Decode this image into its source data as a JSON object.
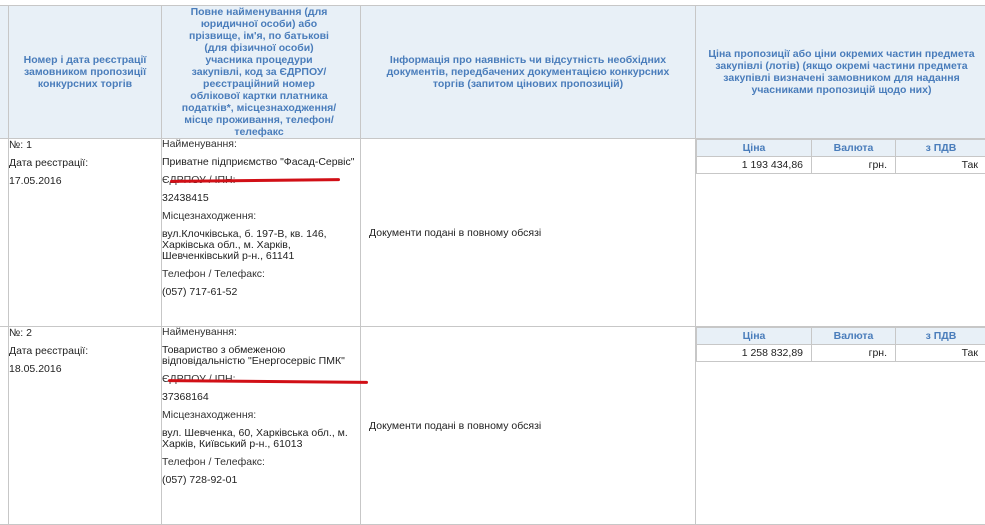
{
  "headers": {
    "number_date": "Номер і дата реєстрації замовником пропозиції конкурсних торгів",
    "participant": "Повне найменування (для юридичної особи) або прізвище, ім'я, по батькові (для фізичної особи) учасника процедури закупівлі, код за ЄДРПОУ/ реєстраційний номер облікової картки платника податків*, місцезнаходження/ місце проживання, телефон/ телефакс",
    "documents": "Інформація про наявність чи відсутність необхідних документів, передбачених документацією конкурсних торгів (запитом цінових пропозицій)",
    "price": "Ціна пропозиції або ціни окремих частин предмета закупівлі (лотів) (якщо окремі частини предмета закупівлі визначені замовником для надання учасниками пропозицій щодо них)"
  },
  "price_headers": {
    "price": "Ціна",
    "currency": "Валюта",
    "vat": "з ПДВ"
  },
  "rows": [
    {
      "number": "№: 1",
      "reg_label": "Дата реєстрації:",
      "reg_date": "17.05.2016",
      "name_label": "Найменування:",
      "name": "Приватне підприємство \"Фасад-Сервіс\"",
      "edrpou_label": "ЄДРПОУ / ІПН:",
      "edrpou": "32438415",
      "address_label": "Місцезнаходження:",
      "address": "вул.Клочківська, б. 197-В, кв. 146, Харківська обл., м. Харків, Шевченківський р-н., 61141",
      "phone_label": "Телефон / Телефакс:",
      "phone": "(057) 717-61-52",
      "documents": "Документи подані в повному обсязі",
      "price": "1 193 434,86",
      "currency": "грн.",
      "vat": "Так"
    },
    {
      "number": "№: 2",
      "reg_label": "Дата реєстрації:",
      "reg_date": "18.05.2016",
      "name_label": "Найменування:",
      "name": "Товариство з обмеженою відповідальністю \"Енергосервіс ПМК\"",
      "edrpou_label": "ЄДРПОУ / ІПН:",
      "edrpou": "37368164",
      "address_label": "Місцезнаходження:",
      "address": "вул. Шевченка, 60, Харківська обл., м. Харків, Київський р-н., 61013",
      "phone_label": "Телефон / Телефакс:",
      "phone": "(057) 728-92-01",
      "documents": "Документи подані в повному обсязі",
      "price": "1 258 832,89",
      "currency": "грн.",
      "vat": "Так"
    }
  ],
  "colors": {
    "header_bg": "#e8f0f7",
    "header_text": "#4a7dbb",
    "border": "#c7c7c7",
    "underline": "#d10f16"
  }
}
